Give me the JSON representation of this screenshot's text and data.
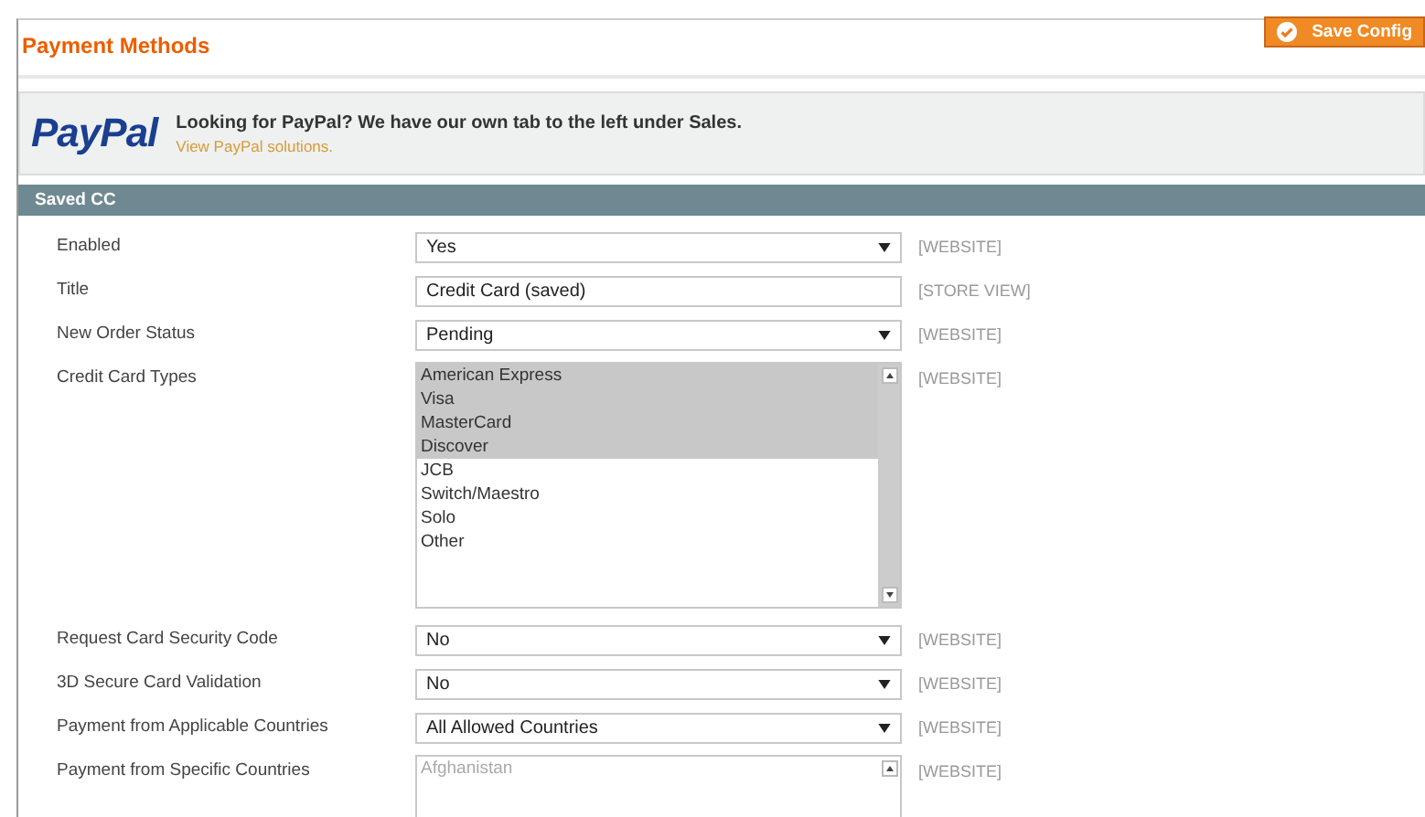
{
  "header": {
    "title": "Payment Methods",
    "save_button": "Save Config"
  },
  "paypal_banner": {
    "logo": "PayPal",
    "message": "Looking for PayPal? We have our own tab to the left under Sales.",
    "link": "View PayPal solutions."
  },
  "section": {
    "title": "Saved CC",
    "rows": [
      {
        "label": "Enabled",
        "kind": "select",
        "value": "Yes",
        "scope": "[WEBSITE]"
      },
      {
        "label": "Title",
        "kind": "text",
        "value": "Credit Card (saved)",
        "scope": "[STORE VIEW]"
      },
      {
        "label": "New Order Status",
        "kind": "select",
        "value": "Pending",
        "scope": "[WEBSITE]"
      },
      {
        "label": "Credit Card Types",
        "kind": "multiselect",
        "disabled": false,
        "scope": "[WEBSITE]",
        "options": [
          {
            "label": "American Express",
            "selected": true
          },
          {
            "label": "Visa",
            "selected": true
          },
          {
            "label": "MasterCard",
            "selected": true
          },
          {
            "label": "Discover",
            "selected": true
          },
          {
            "label": "JCB",
            "selected": false
          },
          {
            "label": "Switch/Maestro",
            "selected": false
          },
          {
            "label": "Solo",
            "selected": false
          },
          {
            "label": "Other",
            "selected": false
          }
        ]
      },
      {
        "label": "Request Card Security Code",
        "kind": "select",
        "value": "No",
        "scope": "[WEBSITE]"
      },
      {
        "label": "3D Secure Card Validation",
        "kind": "select",
        "value": "No",
        "scope": "[WEBSITE]"
      },
      {
        "label": "Payment from Applicable Countries",
        "kind": "select",
        "value": "All Allowed Countries",
        "scope": "[WEBSITE]"
      },
      {
        "label": "Payment from Specific Countries",
        "kind": "multiselect",
        "disabled": true,
        "scope": "[WEBSITE]",
        "options": [
          {
            "label": "Afghanistan",
            "selected": false
          }
        ]
      }
    ]
  }
}
